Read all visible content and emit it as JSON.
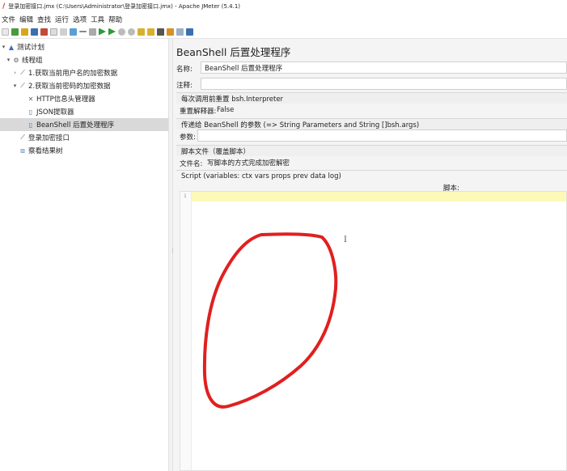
{
  "window": {
    "title": "登录加密接口.jmx (C:\\Users\\Administrator\\登录加密接口.jmx) - Apache JMeter (5.4.1)"
  },
  "menu": [
    "文件",
    "编辑",
    "查找",
    "运行",
    "选项",
    "工具",
    "帮助"
  ],
  "tree": {
    "items": [
      {
        "label": "测试计划",
        "twisty": "▾",
        "icon": "test-plan-icon"
      },
      {
        "label": "线程组",
        "twisty": "▾",
        "icon": "thread-group-icon"
      },
      {
        "label": "1.获取当前用户名的加密数据",
        "twisty": "›",
        "icon": "sampler-icon"
      },
      {
        "label": "2.获取当前密码的加密数据",
        "twisty": "▾",
        "icon": "sampler-icon"
      },
      {
        "label": "HTTP信息头管理器",
        "twisty": "",
        "icon": "header-manager-icon"
      },
      {
        "label": "JSON提取器",
        "twisty": "",
        "icon": "extractor-icon"
      },
      {
        "label": "BeanShell 后置处理程序",
        "twisty": "",
        "icon": "beanshell-icon"
      },
      {
        "label": "登录加密接口",
        "twisty": "",
        "icon": "sampler-icon"
      },
      {
        "label": "察看结果树",
        "twisty": "",
        "icon": "listener-icon"
      }
    ]
  },
  "panel": {
    "title": "BeanShell 后置处理程序",
    "name_label": "名称:",
    "name_value": "BeanShell 后置处理程序",
    "comment_label": "注释:",
    "comment_value": "",
    "reset_group": "每次调用前重置 bsh.Interpreter",
    "reset_label": "重置解释器:",
    "reset_value": "False",
    "params_group": "传递给 BeanShell 的参数 (=> String Parameters and String []bsh.args)",
    "params_label": "参数:",
    "params_value": "",
    "scriptfile_group": "脚本文件（覆盖脚本）",
    "filename_label": "文件名:",
    "filename_value": "写脚本的方式完成加密解密",
    "script_group": "Script (variables: ctx vars props prev data log)",
    "script_header": "脚本:",
    "line_number": "1"
  },
  "colors": {
    "annotation": "#e02020",
    "selected_row": "#d9d9d9",
    "current_line": "#fdf9b8"
  }
}
